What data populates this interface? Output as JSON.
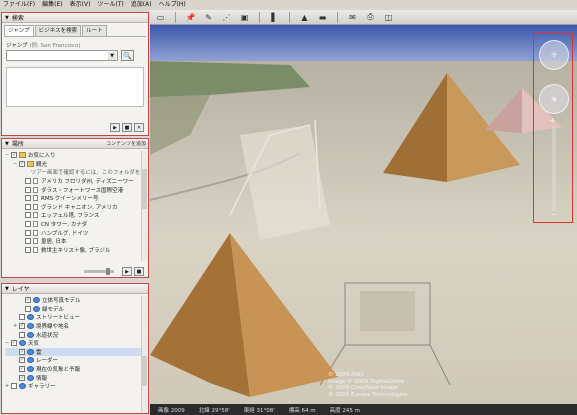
{
  "menu": [
    "ファイル(F)",
    "編集(E)",
    "表示(V)",
    "ツール(T)",
    "追加(A)",
    "ヘルプ(H)"
  ],
  "toolbar": {
    "icons": [
      "sidebar-toggle-icon",
      "placemark-icon",
      "polygon-icon",
      "path-icon",
      "overlay-icon",
      "tour-icon",
      "sky-icon",
      "email-icon",
      "print-icon",
      "view-in-maps-icon"
    ]
  },
  "search": {
    "title": "検索",
    "tabs": [
      "ジャンプ",
      "ビジネスを検索",
      "ルート"
    ],
    "jump_label": "ジャンプ",
    "jump_example": "(例: San Francisco)",
    "query": "",
    "search_button": "🔍"
  },
  "places": {
    "title": "場所",
    "add_content": "コンテンツを追加",
    "items": [
      {
        "label": "お気に入り",
        "level": 1,
        "icon": "folder",
        "expand": "−",
        "checked": true
      },
      {
        "label": "観光",
        "level": 2,
        "icon": "folder",
        "expand": "−",
        "checked": true
      },
      {
        "label": "ツアー画面で確認するには、このフォルダを選択して[ツアーの再生]ボタン",
        "level": 3,
        "icon": "none",
        "expand": "",
        "checked": false
      },
      {
        "label": "アメリカ フロリダ州, ディズニーワー",
        "level": 3,
        "icon": "place",
        "expand": "",
        "checked": false
      },
      {
        "label": "ダラス・フォートワース国際空港",
        "level": 3,
        "icon": "place",
        "expand": "",
        "checked": false
      },
      {
        "label": "RMS クイーンメリー号",
        "level": 3,
        "icon": "place",
        "expand": "",
        "checked": false
      },
      {
        "label": "グランド キャニオン, アメリカ",
        "level": 3,
        "icon": "place",
        "expand": "",
        "checked": false
      },
      {
        "label": "エッフェル塔, フランス",
        "level": 3,
        "icon": "place",
        "expand": "",
        "checked": false
      },
      {
        "label": "CN タワー, カナダ",
        "level": 3,
        "icon": "place",
        "expand": "",
        "checked": false
      },
      {
        "label": "ハンブルグ, ドイツ",
        "level": 3,
        "icon": "place",
        "expand": "",
        "checked": false
      },
      {
        "label": "皇居, 日本",
        "level": 3,
        "icon": "place",
        "expand": "",
        "checked": false
      },
      {
        "label": "救世主キリスト像, ブラジル",
        "level": 3,
        "icon": "place",
        "expand": "",
        "checked": false
      }
    ]
  },
  "layers": {
    "title": "レイヤ",
    "items": [
      {
        "label": "立体写真モデル",
        "level": 3,
        "expand": "",
        "checked": true,
        "icon": "building",
        "selected": false
      },
      {
        "label": "緑モデル",
        "level": 3,
        "expand": "",
        "checked": false,
        "icon": "building",
        "selected": false
      },
      {
        "label": "ストリートビュー",
        "level": 2,
        "expand": "",
        "checked": false,
        "icon": "street",
        "selected": false
      },
      {
        "label": "境界線や地名",
        "level": 2,
        "expand": "+",
        "checked": true,
        "icon": "border",
        "selected": false
      },
      {
        "label": "水道状況",
        "level": 2,
        "expand": "",
        "checked": false,
        "icon": "water",
        "selected": false
      },
      {
        "label": "天気",
        "level": 1,
        "expand": "−",
        "checked": true,
        "icon": "weather",
        "selected": false
      },
      {
        "label": "雲",
        "level": 2,
        "expand": "",
        "checked": true,
        "icon": "cloud",
        "selected": true
      },
      {
        "label": "レーダー",
        "level": 2,
        "expand": "",
        "checked": true,
        "icon": "radar",
        "selected": false
      },
      {
        "label": "現在の気象と予報",
        "level": 2,
        "expand": "",
        "checked": true,
        "icon": "forecast",
        "selected": false
      },
      {
        "label": "情報",
        "level": 2,
        "expand": "",
        "checked": true,
        "icon": "info",
        "selected": false
      },
      {
        "label": "ギャラリー",
        "level": 1,
        "expand": "+",
        "checked": false,
        "icon": "gallery",
        "selected": false
      }
    ]
  },
  "map": {
    "copyright_lines": [
      "© 2009 AND",
      "Image © 2009 DigitalGlobe",
      "© 2009 Cnes/Spot Image",
      "© 2009 Europa Technologies"
    ],
    "status": [
      "画像 2009",
      "北緯 29°58'",
      "東経 31°08'",
      "標高 64 m",
      "高度 245 m"
    ]
  },
  "colors": {
    "accent_frame": "#cc3333",
    "sky": "#4a67b8",
    "sand": "#d8d2c2",
    "pyramid": "#b9884f"
  }
}
